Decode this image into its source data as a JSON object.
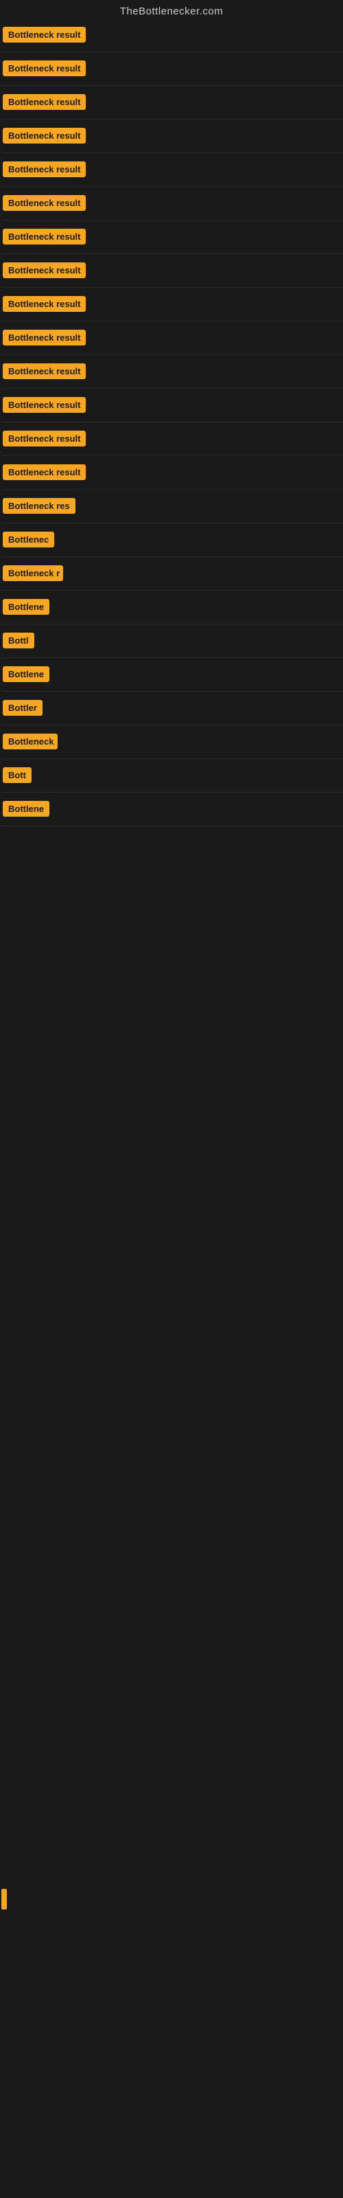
{
  "site": {
    "title": "TheBottlenecker.com"
  },
  "rows": [
    {
      "id": 1,
      "label": "Bottleneck result",
      "badge_width": 140
    },
    {
      "id": 2,
      "label": "Bottleneck result",
      "badge_width": 140
    },
    {
      "id": 3,
      "label": "Bottleneck result",
      "badge_width": 140
    },
    {
      "id": 4,
      "label": "Bottleneck result",
      "badge_width": 140
    },
    {
      "id": 5,
      "label": "Bottleneck result",
      "badge_width": 140
    },
    {
      "id": 6,
      "label": "Bottleneck result",
      "badge_width": 140
    },
    {
      "id": 7,
      "label": "Bottleneck result",
      "badge_width": 140
    },
    {
      "id": 8,
      "label": "Bottleneck result",
      "badge_width": 140
    },
    {
      "id": 9,
      "label": "Bottleneck result",
      "badge_width": 140
    },
    {
      "id": 10,
      "label": "Bottleneck result",
      "badge_width": 140
    },
    {
      "id": 11,
      "label": "Bottleneck result",
      "badge_width": 140
    },
    {
      "id": 12,
      "label": "Bottleneck result",
      "badge_width": 140
    },
    {
      "id": 13,
      "label": "Bottleneck result",
      "badge_width": 140
    },
    {
      "id": 14,
      "label": "Bottleneck result",
      "badge_width": 140
    },
    {
      "id": 15,
      "label": "Bottleneck res",
      "badge_width": 112
    },
    {
      "id": 16,
      "label": "Bottlenec",
      "badge_width": 76
    },
    {
      "id": 17,
      "label": "Bottleneck r",
      "badge_width": 88
    },
    {
      "id": 18,
      "label": "Bottlene",
      "badge_width": 70
    },
    {
      "id": 19,
      "label": "Bottl",
      "badge_width": 50
    },
    {
      "id": 20,
      "label": "Bottlene",
      "badge_width": 70
    },
    {
      "id": 21,
      "label": "Bottler",
      "badge_width": 58
    },
    {
      "id": 22,
      "label": "Bottleneck",
      "badge_width": 80
    },
    {
      "id": 23,
      "label": "Bott",
      "badge_width": 44
    },
    {
      "id": 24,
      "label": "Bottlene",
      "badge_width": 70
    }
  ],
  "colors": {
    "badge_bg": "#f5a623",
    "badge_text": "#1a1a1a",
    "site_title": "#cccccc",
    "bg": "#1a1a1a",
    "row_border": "#2a2a2a"
  }
}
